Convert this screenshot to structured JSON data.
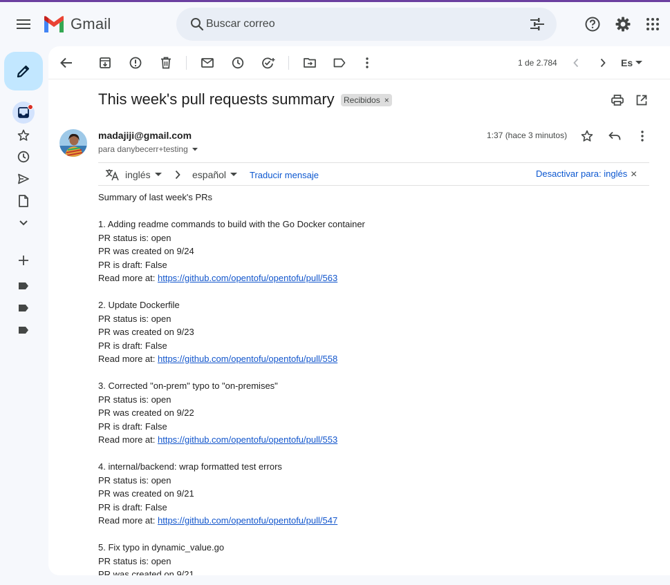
{
  "header": {
    "app_name": "Gmail",
    "search_placeholder": "Buscar correo"
  },
  "toolbar": {
    "pager": "1 de 2.784",
    "language": "Es"
  },
  "email": {
    "subject": "This week's pull requests summary",
    "label": "Recibidos",
    "sender": "madajiji@gmail.com",
    "recipient": "para danybecerr+testing",
    "time": "1:37 (hace 3 minutos)"
  },
  "translate": {
    "from": "inglés",
    "to": "español",
    "translate_link": "Traducir mensaje",
    "disable_link": "Desactivar para: inglés"
  },
  "body": {
    "intro": "Summary of last week's PRs",
    "read_more_prefix": "Read more at: ",
    "items": [
      {
        "title": "1. Adding readme commands to build with the Go Docker container",
        "status": "PR status is: open",
        "created": "PR was created on 9/24",
        "draft": "PR is draft: False",
        "url": "https://github.com/opentofu/opentofu/pull/563"
      },
      {
        "title": "2. Update Dockerfile",
        "status": "PR status is: open",
        "created": "PR was created on 9/23",
        "draft": "PR is draft: False",
        "url": "https://github.com/opentofu/opentofu/pull/558"
      },
      {
        "title": "3. Corrected \"on-prem\" typo to \"on-premises\"",
        "status": "PR status is: open",
        "created": "PR was created on 9/22",
        "draft": "PR is draft: False",
        "url": "https://github.com/opentofu/opentofu/pull/553"
      },
      {
        "title": "4. internal/backend: wrap formatted test errors",
        "status": "PR status is: open",
        "created": "PR was created on 9/21",
        "draft": "PR is draft: False",
        "url": "https://github.com/opentofu/opentofu/pull/547"
      },
      {
        "title": "5. Fix typo in dynamic_value.go",
        "status": "PR status is: open",
        "created": "PR was created on 9/21"
      }
    ]
  },
  "colors": {
    "accent": "#0b57d0",
    "compose_bg": "#c2e7ff",
    "link": "#1155cc",
    "unread_dot": "#d93025"
  }
}
